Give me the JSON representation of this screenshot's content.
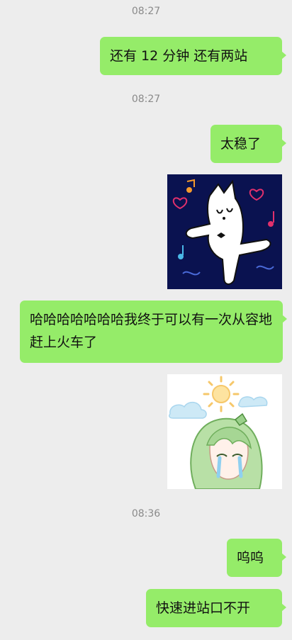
{
  "messages": [
    {
      "type": "timestamp",
      "text": "08:27"
    },
    {
      "type": "text",
      "text": "还有 12 分钟 还有两站"
    },
    {
      "type": "timestamp",
      "text": "08:27"
    },
    {
      "type": "text",
      "text": "太稳了"
    },
    {
      "type": "sticker",
      "icon": "dancing-cat-sticker"
    },
    {
      "type": "text",
      "text": "哈哈哈哈哈哈哈我终于可以有一次从容地赶上火车了"
    },
    {
      "type": "sticker",
      "icon": "crying-anime-girl-sticker"
    },
    {
      "type": "timestamp",
      "text": "08:36"
    },
    {
      "type": "text",
      "text": "呜呜"
    },
    {
      "type": "text",
      "text": "快速进站口不开"
    }
  ],
  "colors": {
    "background": "#ededed",
    "bubble": "#95ec69",
    "timestamp": "#8a8a8a",
    "sticker_bg_dark": "#0a1250"
  }
}
